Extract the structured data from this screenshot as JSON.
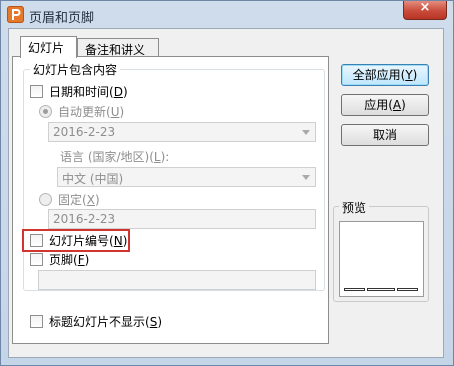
{
  "window": {
    "title": "页眉和页脚",
    "close_symbol": "×"
  },
  "tabs": [
    {
      "label": "幻灯片",
      "active": true
    },
    {
      "label": "备注和讲义",
      "active": false
    }
  ],
  "slide_content": {
    "group_title": "幻灯片包含内容",
    "date_time": {
      "label": "日期和时间",
      "accel": "D",
      "checked": false
    },
    "auto_update": {
      "label": "自动更新",
      "accel": "U",
      "selected": true,
      "disabled": true
    },
    "auto_date_value": "2016-2-23",
    "language": {
      "label": "语言 (国家/地区)",
      "accel": "L",
      "suffix": ":",
      "value": "中文 (中国)"
    },
    "fixed": {
      "label": "固定",
      "accel": "X",
      "selected": false,
      "disabled": true
    },
    "fixed_date_value": "2016-2-23",
    "slide_number": {
      "label": "幻灯片编号",
      "accel": "N",
      "checked": false
    },
    "footer": {
      "label": "页脚",
      "accel": "F",
      "checked": false,
      "value": ""
    }
  },
  "title_slide_option": {
    "label": "标题幻灯片不显示",
    "accel": "S",
    "checked": false
  },
  "buttons": {
    "apply_all": {
      "label": "全部应用",
      "accel": "Y"
    },
    "apply": {
      "label": "应用",
      "accel": "A"
    },
    "cancel": {
      "label": "取消"
    }
  },
  "preview": {
    "label": "预览"
  },
  "colors": {
    "highlight_border": "#d1352f",
    "default_button_border": "#3c7fb1",
    "app_icon": "#e6782c"
  }
}
